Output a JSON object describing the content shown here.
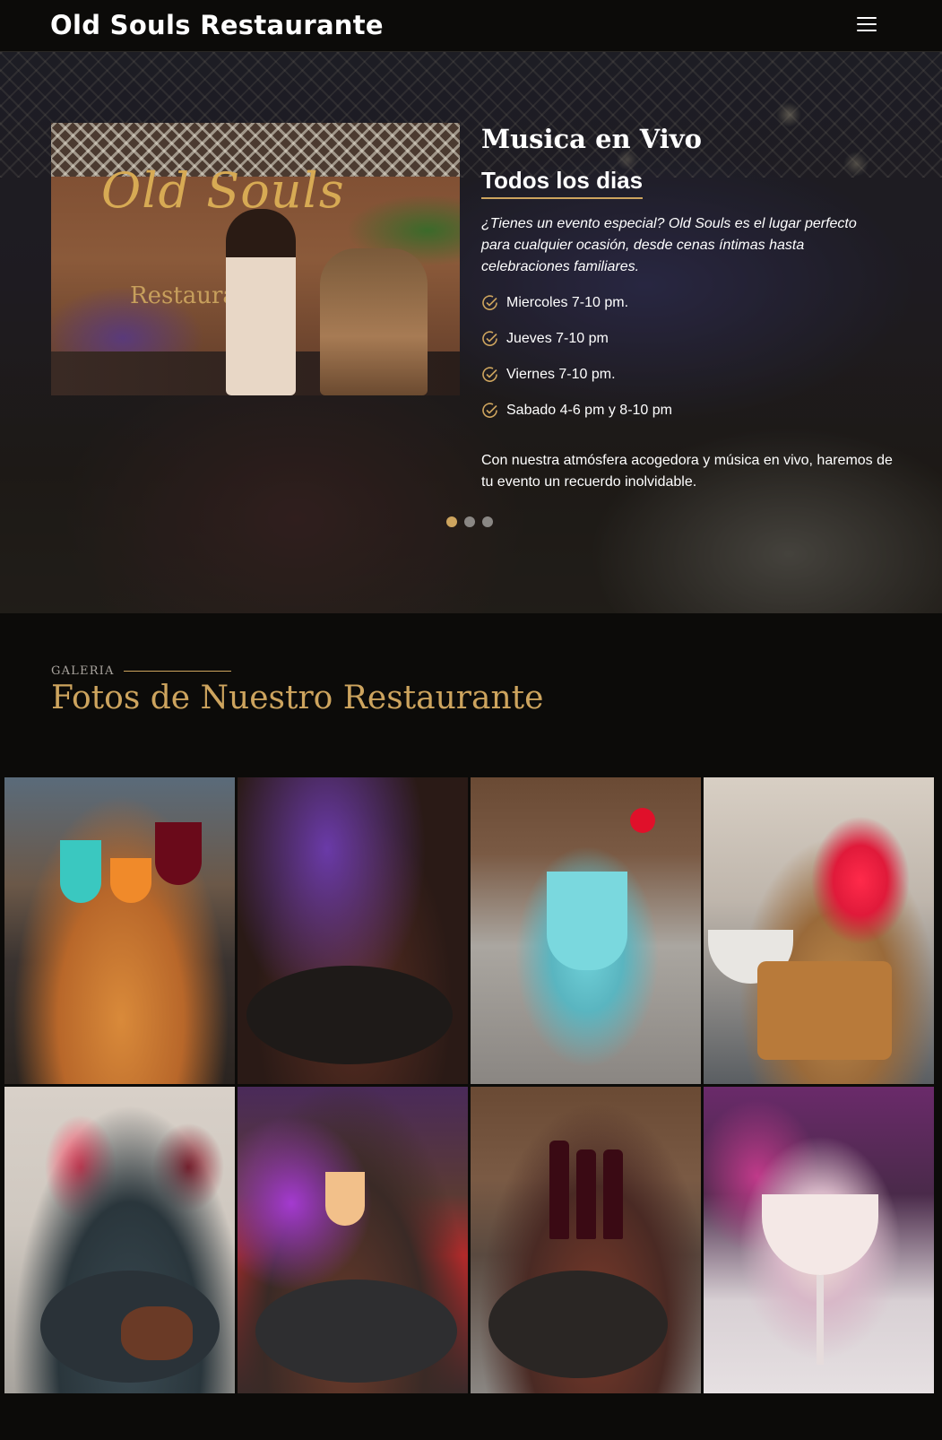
{
  "header": {
    "logo": "Old Souls Restaurante",
    "menu_icon": "hamburger-menu-icon"
  },
  "hero": {
    "photo_sign": "Old Souls",
    "photo_sign_sub": "Restaurante",
    "title": "Musica en Vivo",
    "subtitle": "Todos los dias",
    "description": "¿Tienes un evento especial? Old Souls es el lugar perfecto para cualquier ocasión, desde cenas íntimas hasta celebraciones familiares.",
    "schedule": [
      "Miercoles 7-10 pm.",
      "Jueves 7-10 pm",
      "Viernes 7-10 pm.",
      "Sabado 4-6 pm y 8-10 pm"
    ],
    "closing": "Con nuestra atmósfera acogedora y música en vivo, haremos de tu evento un recuerdo inolvidable.",
    "carousel": {
      "slides": 3,
      "active": 1
    }
  },
  "gallery": {
    "tag": "GALERIA",
    "title": "Fotos de Nuestro Restaurante",
    "photos": 8
  },
  "colors": {
    "background": "#0c0b09",
    "accent": "#cda45e",
    "text": "#ffffff",
    "muted": "#aaa59f"
  }
}
